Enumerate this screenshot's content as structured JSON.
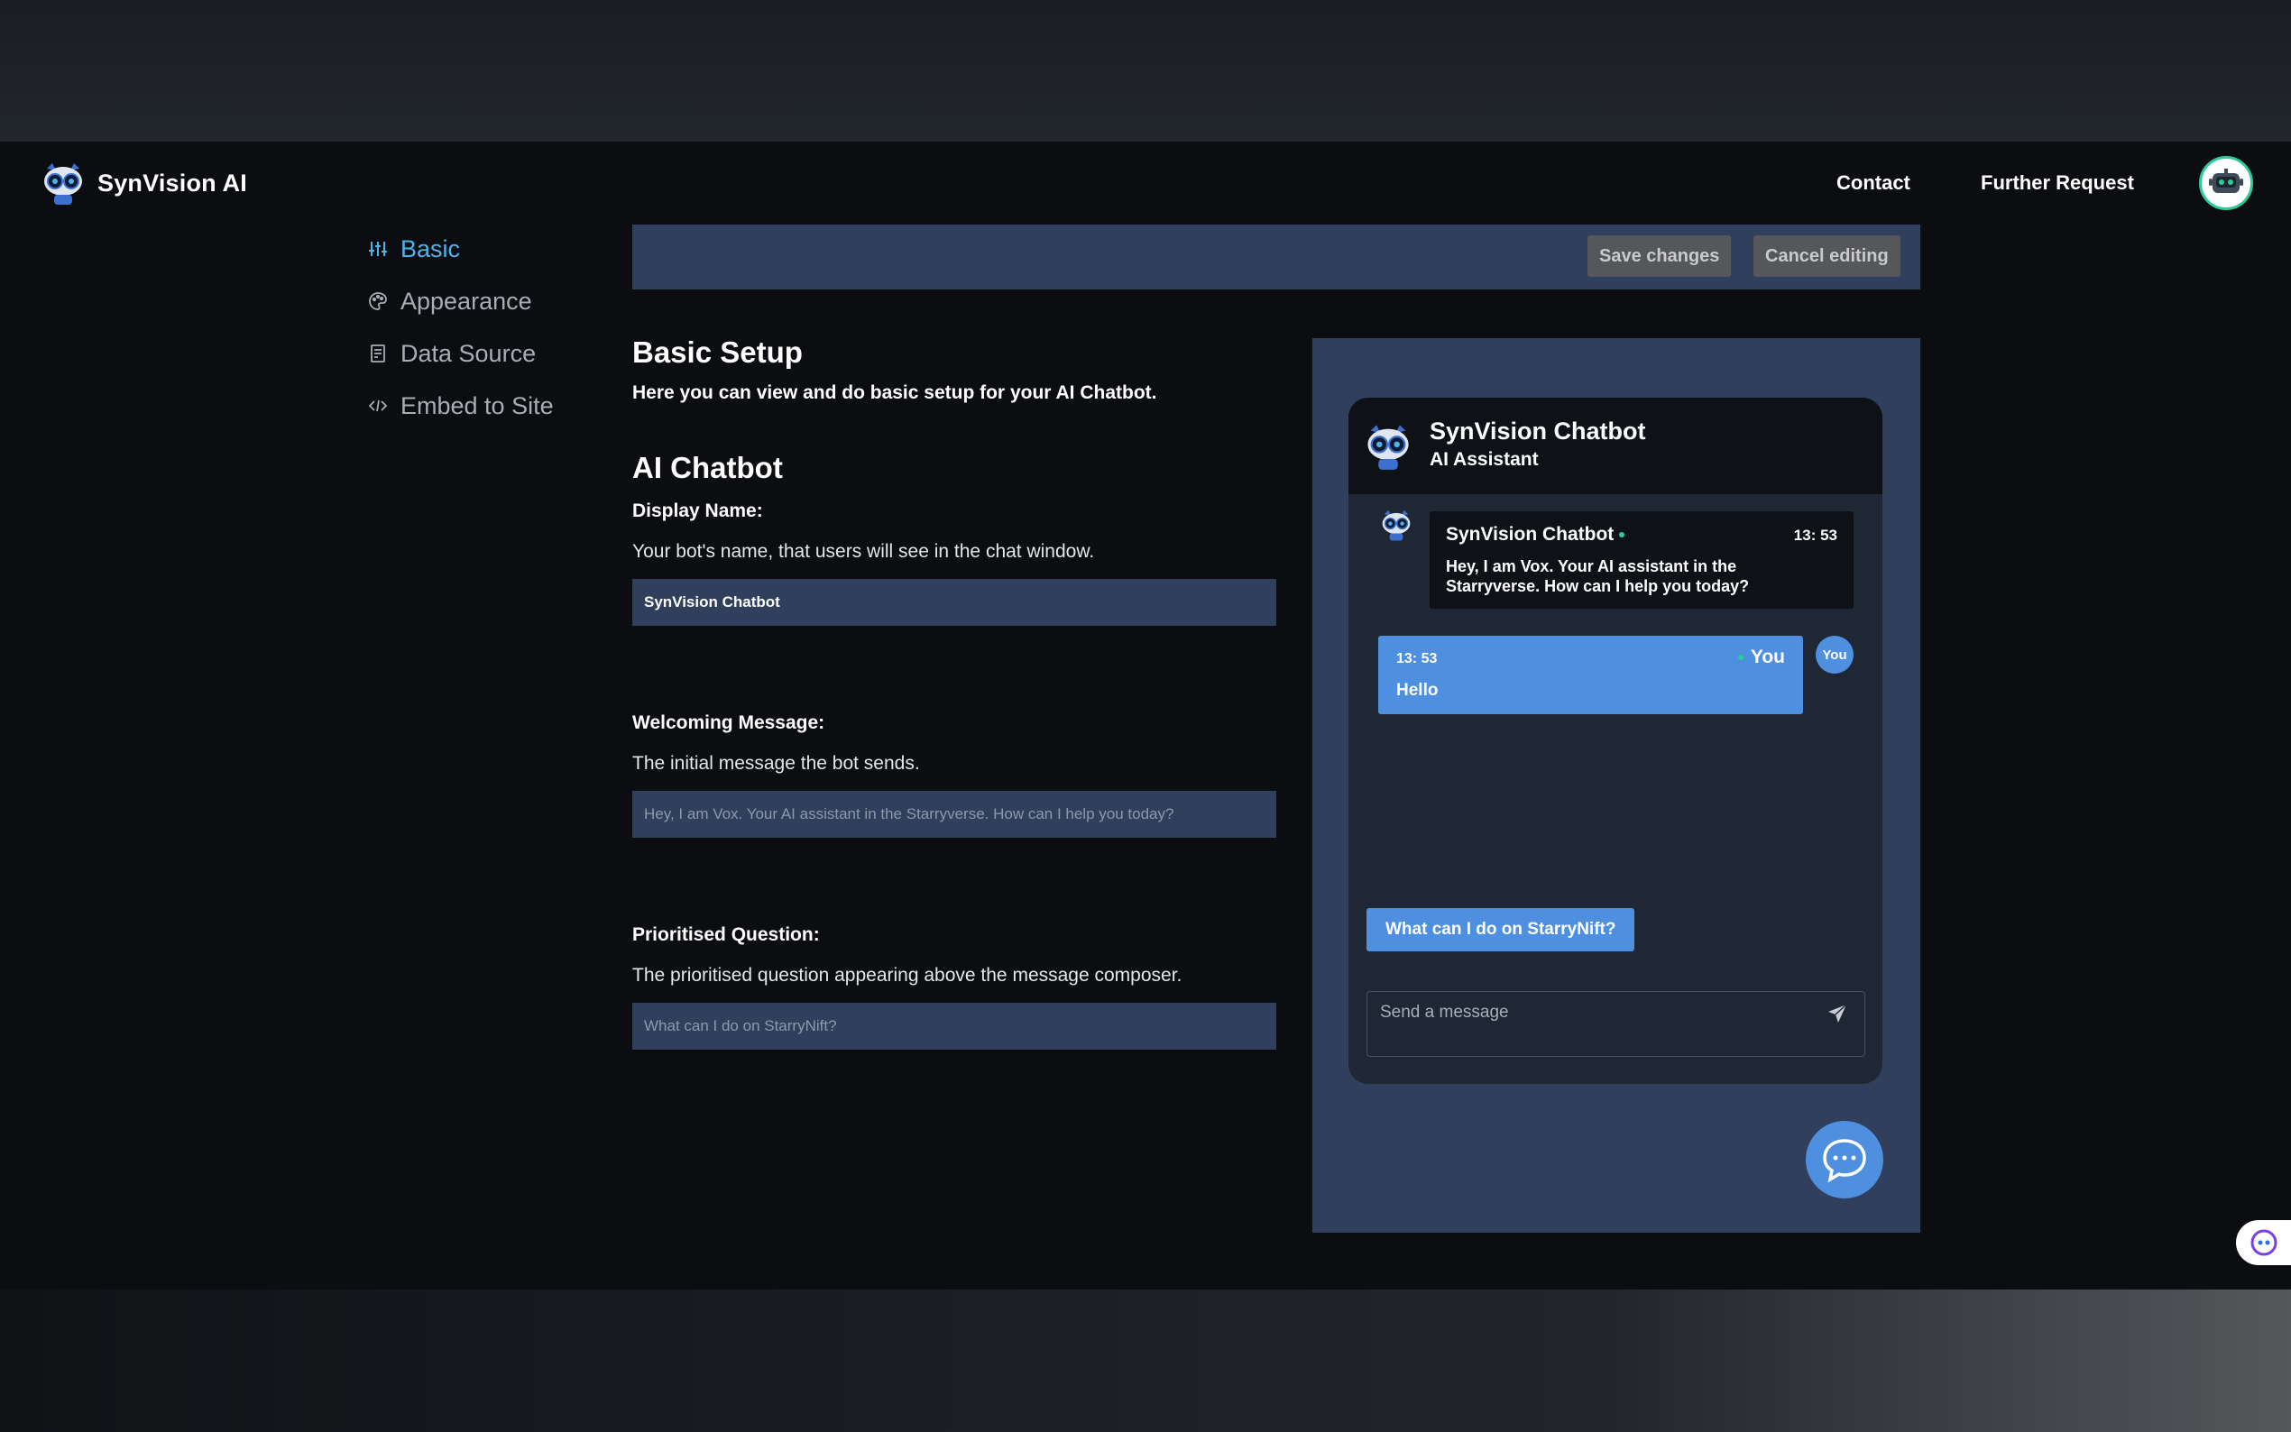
{
  "header": {
    "brand_name": "SynVision AI",
    "nav": {
      "contact": "Contact",
      "further_request": "Further Request"
    }
  },
  "sidebar": {
    "items": [
      {
        "label": "Basic",
        "icon": "sliders-icon",
        "active": true
      },
      {
        "label": "Appearance",
        "icon": "palette-icon",
        "active": false
      },
      {
        "label": "Data Source",
        "icon": "document-icon",
        "active": false
      },
      {
        "label": "Embed to Site",
        "icon": "code-icon",
        "active": false
      }
    ]
  },
  "toolbar": {
    "save_label": "Save changes",
    "cancel_label": "Cancel editing"
  },
  "form": {
    "title": "Basic Setup",
    "subtitle": "Here you can view and do basic setup for your AI Chatbot.",
    "section_title": "AI Chatbot",
    "display_name": {
      "label": "Display Name:",
      "help": "Your bot's name, that users will see in the chat window.",
      "value": "SynVision Chatbot"
    },
    "welcome": {
      "label": "Welcoming Message:",
      "help": "The initial message the bot sends.",
      "placeholder": "Hey, I am Vox. Your AI assistant in the Starryverse. How can I help you today?"
    },
    "prioritised": {
      "label": "Prioritised Question:",
      "help": "The prioritised question appearing above the message composer.",
      "placeholder": "What can I do on StarryNift?"
    }
  },
  "preview": {
    "header_title": "SynVision Chatbot",
    "header_subtitle": "AI Assistant",
    "bot_message": {
      "name": "SynVision Chatbot",
      "time": "13: 53",
      "text": "Hey, I am Vox. Your AI assistant in the Starryverse. How can I help you today?"
    },
    "user_message": {
      "name": "You",
      "time": "13: 53",
      "text": "Hello",
      "avatar_label": "You"
    },
    "prioritised_button": "What can I do on StarryNift?",
    "composer_placeholder": "Send a message"
  },
  "colors": {
    "accent": "#4f8fe0",
    "active_nav": "#4fb3e8",
    "panel": "#2f3f5c",
    "online": "#2ccc9a"
  }
}
